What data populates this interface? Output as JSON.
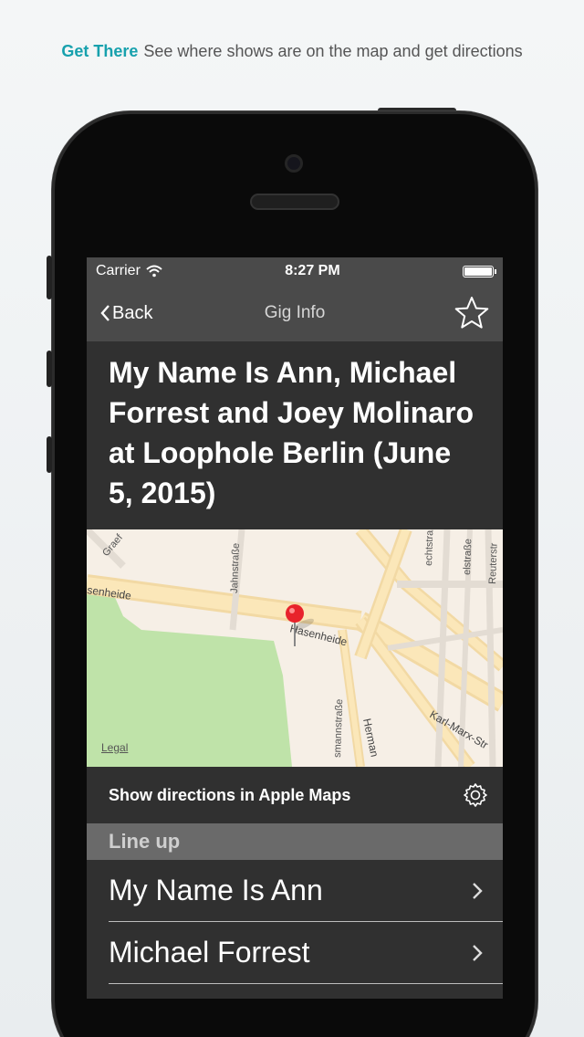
{
  "caption": {
    "highlight": "Get There",
    "text": "See where shows are on the map and get directions"
  },
  "status_bar": {
    "carrier": "Carrier",
    "time": "8:27 PM"
  },
  "nav": {
    "back_label": "Back",
    "title": "Gig Info"
  },
  "gig": {
    "title": "My Name Is Ann, Michael Forrest and Joey Molinaro at Loophole Berlin (June 5, 2015)"
  },
  "map": {
    "legal": "Legal",
    "streets": [
      "Graef",
      "senheide",
      "Jahnstraße",
      "Hasenheide",
      "smannstraße",
      "Herman",
      "Karl-Marx-Str",
      "echtstraße",
      "elstraße",
      "Reuterstr"
    ]
  },
  "directions": {
    "label": "Show directions in Apple Maps"
  },
  "lineup": {
    "header": "Line up",
    "items": [
      {
        "name": "My Name Is Ann"
      },
      {
        "name": "Michael Forrest"
      }
    ]
  },
  "colors": {
    "accent": "#17a1ad",
    "nav_bg": "#4a4a4a",
    "screen_bg": "#303030",
    "section_bg": "#6a6a6a"
  }
}
